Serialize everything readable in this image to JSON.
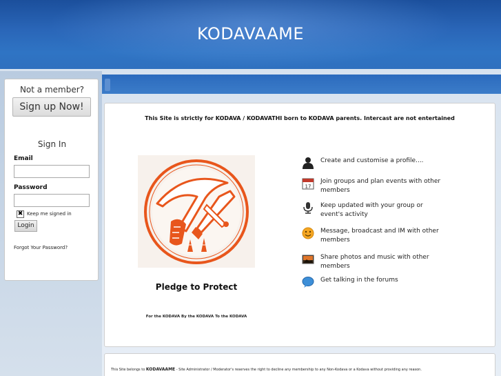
{
  "header": {
    "title": "KODAVAAME"
  },
  "sidebar": {
    "not_member": "Not a member?",
    "signup_label": "Sign up Now!",
    "signin_title": "Sign In",
    "email_label": "Email",
    "password_label": "Password",
    "checkbox_mark": "✖",
    "keep_signed": "Keep me signed in",
    "login_label": "Login",
    "forgot": "Forgot Your Password?"
  },
  "main": {
    "notice": "This Site is strictly for KODAVA / KODAVATHI born to KODAVA parents. Intercast are not entertained",
    "pledge": "Pledge to Protect",
    "motto": "For the KODAVA By the KODAVA To the KODAVA",
    "features": [
      {
        "icon": "person-icon",
        "text": "Create and customise a profile...."
      },
      {
        "icon": "calendar-icon",
        "text": "Join groups and plan events with other members",
        "badge": "17"
      },
      {
        "icon": "microphone-icon",
        "text": "Keep updated with your group or event's activity"
      },
      {
        "icon": "smiley-icon",
        "text": "Message, broadcast and IM with other members"
      },
      {
        "icon": "photo-icon",
        "text": "Share photos and music with other members"
      },
      {
        "icon": "speech-bubble-icon",
        "text": "Get talking in the forums"
      }
    ]
  },
  "footer": {
    "site_name": "KODAVAAME",
    "prefix": "This Site belongs to",
    "suffix": "- Site Administrator / Moderator's reserves the right to decline any membership to any Non-Kodava or a Kodava without providing any reason."
  },
  "colors": {
    "header_blue": "#2a66b8",
    "emblem_orange": "#e8561c"
  }
}
